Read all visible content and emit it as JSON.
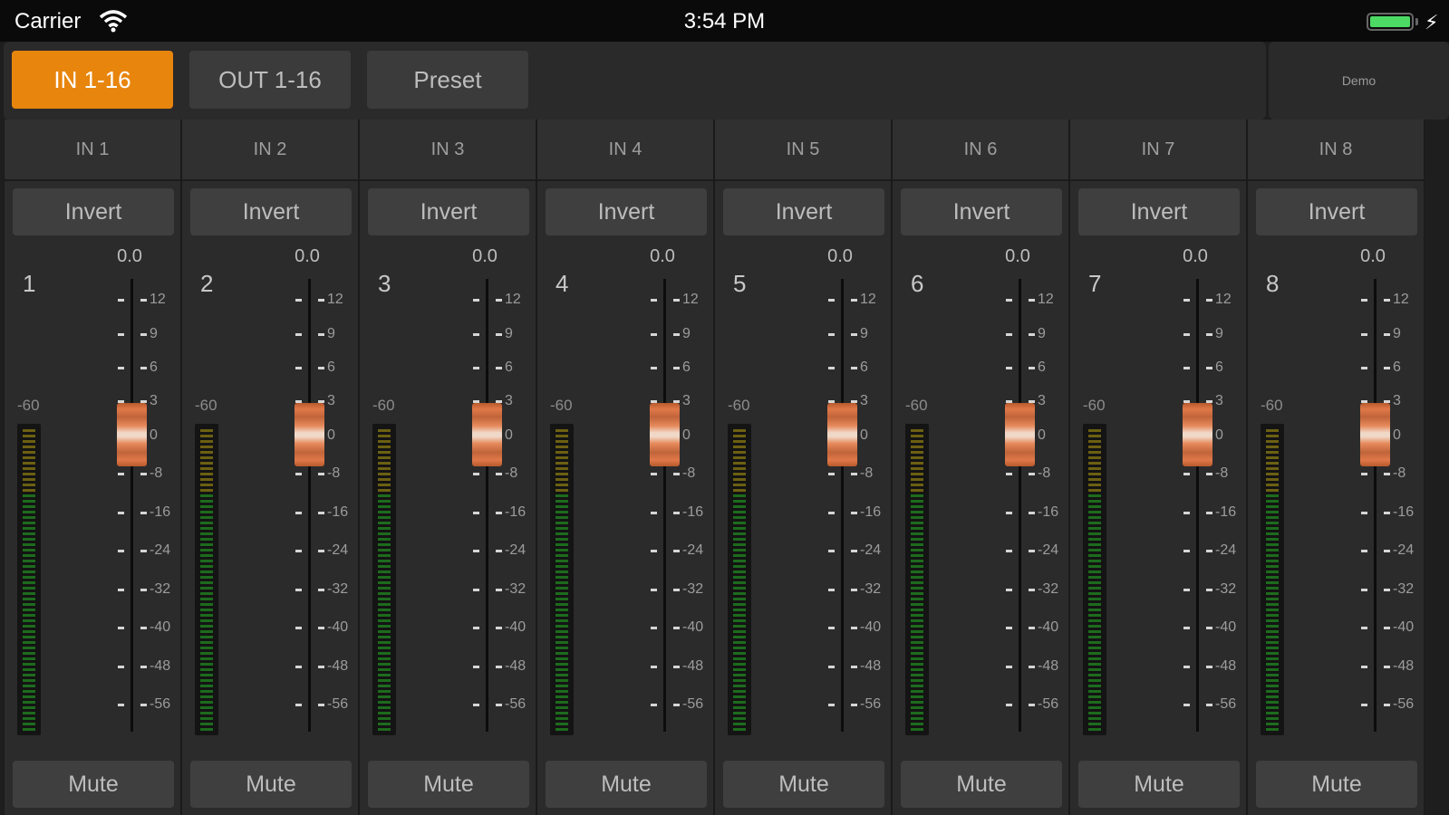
{
  "status_bar": {
    "carrier": "Carrier",
    "time": "3:54 PM"
  },
  "tabs": [
    {
      "label": "IN 1-16",
      "active": true
    },
    {
      "label": "OUT 1-16",
      "active": false
    },
    {
      "label": "Preset",
      "active": false
    }
  ],
  "demo_label": "Demo",
  "colors": {
    "accent": "#e8850d",
    "meter_green": "#1f7a1f",
    "meter_yellow": "#8a7a12",
    "fader_knob": "#e07848",
    "battery": "#4cd964"
  },
  "meter_floor_label": "-60",
  "fader_scale": [
    "12",
    "9",
    "6",
    "3",
    "0",
    "-8",
    "-16",
    "-24",
    "-32",
    "-40",
    "-48",
    "-56"
  ],
  "channels": [
    {
      "name": "IN 1",
      "number": "1",
      "gain": "0.0",
      "invert_label": "Invert",
      "mute_label": "Mute",
      "fader_db": 0
    },
    {
      "name": "IN 2",
      "number": "2",
      "gain": "0.0",
      "invert_label": "Invert",
      "mute_label": "Mute",
      "fader_db": 0
    },
    {
      "name": "IN 3",
      "number": "3",
      "gain": "0.0",
      "invert_label": "Invert",
      "mute_label": "Mute",
      "fader_db": 0
    },
    {
      "name": "IN 4",
      "number": "4",
      "gain": "0.0",
      "invert_label": "Invert",
      "mute_label": "Mute",
      "fader_db": 0
    },
    {
      "name": "IN 5",
      "number": "5",
      "gain": "0.0",
      "invert_label": "Invert",
      "mute_label": "Mute",
      "fader_db": 0
    },
    {
      "name": "IN 6",
      "number": "6",
      "gain": "0.0",
      "invert_label": "Invert",
      "mute_label": "Mute",
      "fader_db": 0
    },
    {
      "name": "IN 7",
      "number": "7",
      "gain": "0.0",
      "invert_label": "Invert",
      "mute_label": "Mute",
      "fader_db": 0
    },
    {
      "name": "IN 8",
      "number": "8",
      "gain": "0.0",
      "invert_label": "Invert",
      "mute_label": "Mute",
      "fader_db": 0
    }
  ]
}
